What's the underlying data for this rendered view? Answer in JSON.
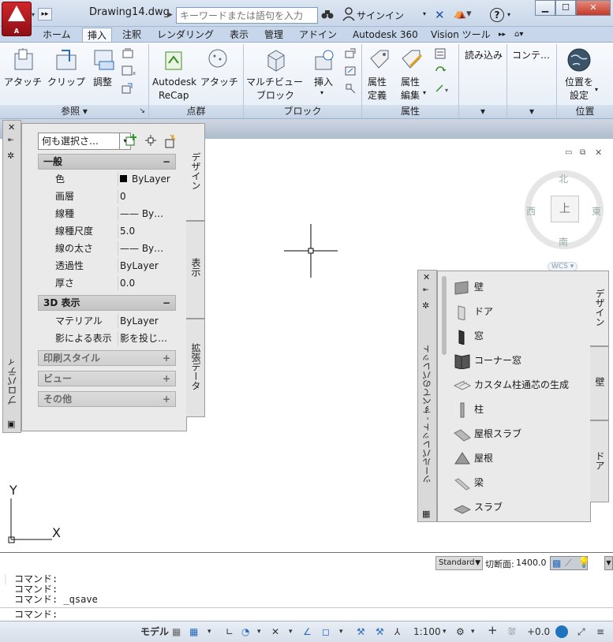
{
  "titlebar": {
    "app_letter": "A",
    "drawing_title": "Drawing14.dwg",
    "search_placeholder": "キーワードまたは語句を入力",
    "signin": "サインイン"
  },
  "tabs": [
    "ホーム",
    "挿入",
    "注釈",
    "レンダリング",
    "表示",
    "管理",
    "アドイン",
    "Autodesk 360",
    "Vision ツール"
  ],
  "active_tab": "挿入",
  "ribbon": {
    "reference": {
      "attach": "アタッチ",
      "clip": "クリップ",
      "adjust": "調整",
      "footer": "参照"
    },
    "pointcloud": {
      "recap_1": "Autodesk",
      "recap_2": "ReCap",
      "attach": "アタッチ",
      "footer": "点群"
    },
    "block": {
      "multiview_1": "マルチビュー",
      "multiview_2": "ブロック",
      "insert": "挿入",
      "footer": "ブロック"
    },
    "attribute": {
      "define_1": "属性",
      "define_2": "定義",
      "edit_1": "属性",
      "edit_2": "編集",
      "footer": "属性"
    },
    "import": {
      "label": "読み込み"
    },
    "content": {
      "label": "コンテ…"
    },
    "location": {
      "set_1": "位置を",
      "set_2": "設定",
      "footer": "位置"
    }
  },
  "properties": {
    "palette_title": "プロパティ",
    "selector": "何も選択さ…",
    "tabs": [
      "デザイン",
      "表示",
      "拡張データ"
    ],
    "general": {
      "title": "一般",
      "rows": [
        {
          "name": "色",
          "value": "ByLayer"
        },
        {
          "name": "画層",
          "value": "0"
        },
        {
          "name": "線種",
          "value": "—— By…"
        },
        {
          "name": "線種尺度",
          "value": "5.0"
        },
        {
          "name": "線の太さ",
          "value": "—— By…"
        },
        {
          "name": "透過性",
          "value": "ByLayer"
        },
        {
          "name": "厚さ",
          "value": "0.0"
        }
      ]
    },
    "display3d": {
      "title": "3D 表示",
      "rows": [
        {
          "name": "マテリアル",
          "value": "ByLayer"
        },
        {
          "name": "影による表示",
          "value": "影を投じ…"
        }
      ]
    },
    "collapsed": [
      "印刷スタイル",
      "ビュー",
      "その他"
    ]
  },
  "tool_palette": {
    "title": "ツールパレット - すべてのパレット",
    "tabs": [
      "デザイン",
      "壁",
      "ドア"
    ],
    "items": [
      "壁",
      "ドア",
      "窓",
      "コーナー窓",
      "カスタム柱通芯の生成",
      "柱",
      "屋根スラブ",
      "屋根",
      "梁",
      "スラブ"
    ]
  },
  "viewcube": {
    "north": "北",
    "south": "南",
    "east": "東",
    "west": "西",
    "top": "上",
    "wcs": "WCS"
  },
  "ucs": {
    "x": "X",
    "y": "Y"
  },
  "command": {
    "history": [
      "コマンド:",
      "コマンド:",
      "コマンド: _qsave"
    ],
    "prompt": "コマンド:"
  },
  "display_bar": {
    "style": "Standard",
    "cut_plane_label": "切断面:",
    "cut_plane_value": "1400.0"
  },
  "statusbar": {
    "model": "モデル",
    "scale": "1:100",
    "elevation": "+0.0"
  },
  "colors": {
    "accent": "#1e73be",
    "app_red": "#c41e24"
  }
}
